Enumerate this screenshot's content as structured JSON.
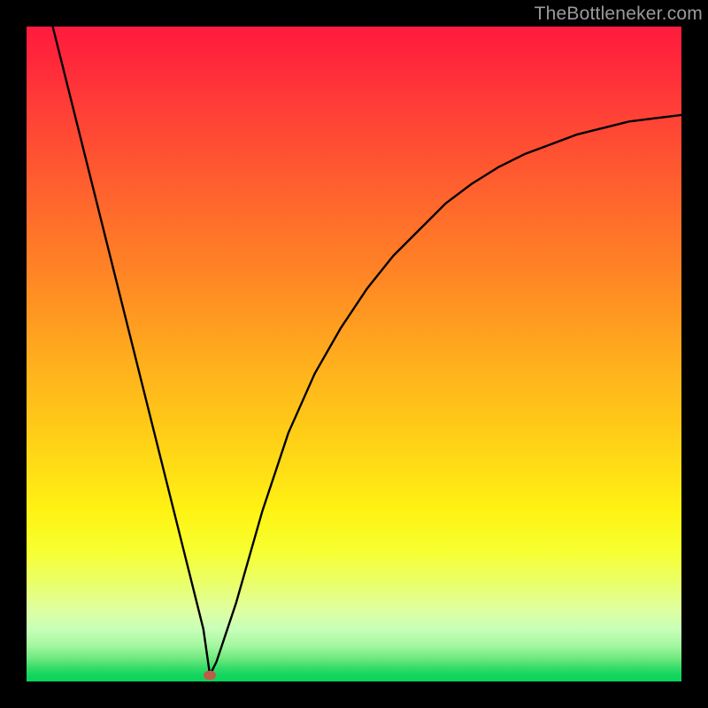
{
  "watermark": "TheBottleneker.com",
  "chart_data": {
    "type": "line",
    "title": "",
    "xlabel": "",
    "ylabel": "",
    "xlim": [
      0,
      100
    ],
    "ylim": [
      0,
      100
    ],
    "min_point": {
      "x": 28,
      "y": 1
    },
    "x": [
      4,
      6,
      8,
      10,
      12,
      14,
      16,
      18,
      20,
      22,
      24,
      25,
      26,
      27,
      28,
      29,
      30,
      32,
      34,
      36,
      38,
      40,
      44,
      48,
      52,
      56,
      60,
      64,
      68,
      72,
      76,
      80,
      84,
      88,
      92,
      96,
      100
    ],
    "values": [
      100,
      92,
      84,
      76,
      68,
      60,
      52,
      44,
      36,
      28,
      20,
      16,
      12,
      8,
      1,
      3,
      6,
      12,
      19,
      26,
      32,
      38,
      47,
      54,
      60,
      65,
      69,
      73,
      76,
      78.5,
      80.5,
      82,
      83.5,
      84.5,
      85.5,
      86,
      86.5
    ],
    "background_gradient": {
      "top_color": "#ff1b3d",
      "mid_color": "#ffd416",
      "bottom_color": "#0ad35a"
    },
    "curve_color": "#000000",
    "marker_color": "#c05a4a"
  }
}
